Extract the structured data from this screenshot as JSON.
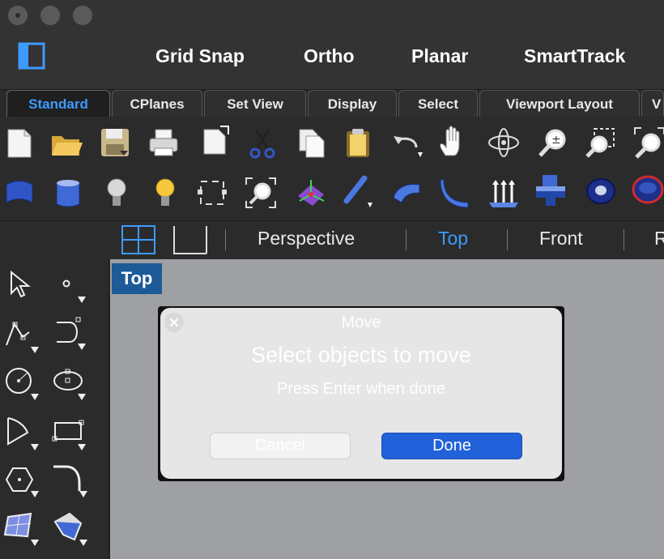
{
  "toggles": [
    "Grid Snap",
    "Ortho",
    "Planar",
    "SmartTrack"
  ],
  "tabs": [
    {
      "label": "Standard",
      "active": true
    },
    {
      "label": "CPlanes"
    },
    {
      "label": "Set View"
    },
    {
      "label": "Display"
    },
    {
      "label": "Select"
    },
    {
      "label": "Viewport Layout"
    },
    {
      "label": "V"
    }
  ],
  "toolbar1_icons": [
    "new-file-icon",
    "open-folder-icon",
    "save-icon",
    "print-icon",
    "import-icon",
    "cut-icon",
    "copy-icon",
    "paste-icon",
    "undo-icon",
    "pan-hand-icon",
    "rotate-view-icon",
    "zoom-icon",
    "zoom-window-icon",
    "zoom-extents-icon"
  ],
  "toolbar2_icons": [
    "surface-patch-icon",
    "extrude-surface-icon",
    "light-bulb-icon",
    "light-bulb-lit-icon",
    "select-frame-icon",
    "zoom-selected-icon",
    "gumball-icon",
    "pipe-tool-icon",
    "bend-icon",
    "curve-icon",
    "normals-icon",
    "boolean-icon",
    "torus-icon",
    "ring-icon"
  ],
  "viewports": {
    "tabs": [
      "Perspective",
      "Top",
      "Front",
      "R"
    ],
    "active": "Top",
    "title": "Top"
  },
  "palette_icons": [
    "select-arrow-icon",
    "point-icon",
    "polyline-icon",
    "curve-icon",
    "circle-icon",
    "ellipse-icon",
    "arc-icon",
    "rectangle-icon",
    "polygon-icon",
    "fillet-icon",
    "surface-icon",
    "sweep-icon"
  ],
  "dialog": {
    "title": "Move",
    "prompt": "Select objects to move",
    "hint": "Press Enter when done",
    "cancel_label": "Cancel",
    "done_label": "Done"
  },
  "colors": {
    "accent": "#3d9bff",
    "done": "#2161d9",
    "viewport": "#9fa0a3",
    "title_badge": "#1d5a98"
  }
}
